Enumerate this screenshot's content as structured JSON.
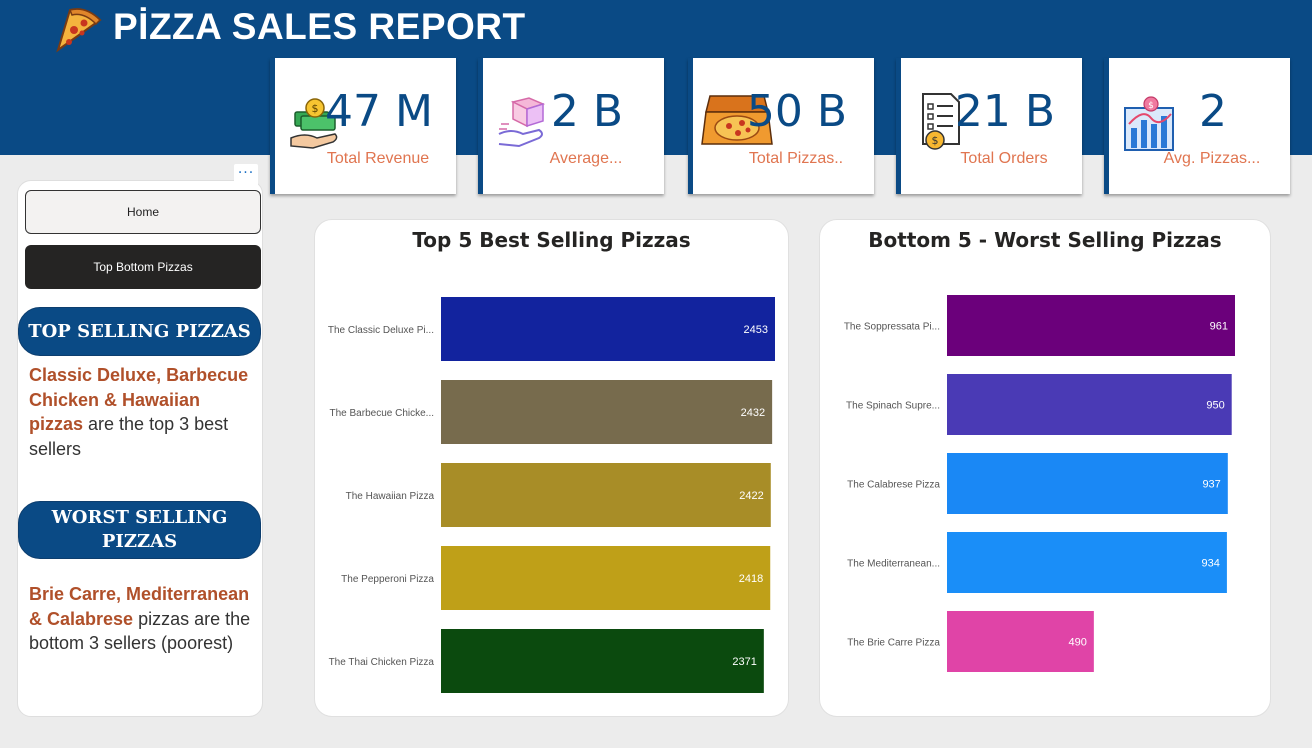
{
  "header": {
    "title": "PİZZA SALES REPORT",
    "logo_icon": "pizza-slice-icon"
  },
  "kpis": [
    {
      "value": "47 M",
      "label": "Total Revenue",
      "icon": "money-hand-icon"
    },
    {
      "value": "2 B",
      "label": "Average...",
      "icon": "box-hand-icon"
    },
    {
      "value": "50 B",
      "label": "Total Pizzas..",
      "icon": "pizza-box-icon"
    },
    {
      "value": "21 B",
      "label": "Total Orders",
      "icon": "order-list-icon"
    },
    {
      "value": "2",
      "label": "Avg. Pizzas...",
      "icon": "bar-chart-icon"
    }
  ],
  "nav": {
    "more": "···",
    "home": "Home",
    "top_bottom": "Top Bottom Pizzas"
  },
  "sidebar": {
    "top_title": "TOP SELLING PIZZAS",
    "top_highlight": "Classic Deluxe, Barbecue Chicken & Hawaiian pizzas",
    "top_rest": " are the top 3 best sellers",
    "worst_title": "WORST SELLING PIZZAS",
    "worst_highlight": "Brie Carre, Mediterranean & Calabrese",
    "worst_rest": " pizzas are the bottom 3 sellers (poorest)"
  },
  "chart_data": [
    {
      "type": "bar",
      "orientation": "horizontal",
      "title": "Top 5 Best Selling Pizzas",
      "categories": [
        "The Classic Deluxe Pi...",
        "The Barbecue Chicke...",
        "The Hawaiian Pizza",
        "The Pepperoni Pizza",
        "The Thai Chicken Pizza"
      ],
      "values": [
        2453,
        2432,
        2422,
        2418,
        2371
      ],
      "colors": [
        "#12239e",
        "#776b4d",
        "#a88d27",
        "#bfa018",
        "#0b4a0e"
      ],
      "xlim": [
        0,
        2453
      ],
      "grid": false,
      "data_labels": true
    },
    {
      "type": "bar",
      "orientation": "horizontal",
      "title": "Bottom 5 - Worst Selling Pizzas",
      "categories": [
        "The Soppressata Pi...",
        "The Spinach Supre...",
        "The Calabrese Pizza",
        "The Mediterranean...",
        "The Brie Carre Pizza"
      ],
      "values": [
        961,
        950,
        937,
        934,
        490
      ],
      "colors": [
        "#6b007b",
        "#4a3ab5",
        "#1a88f5",
        "#1a8ef8",
        "#e044a7"
      ],
      "xlim": [
        0,
        961
      ],
      "grid": false,
      "data_labels": true
    }
  ]
}
